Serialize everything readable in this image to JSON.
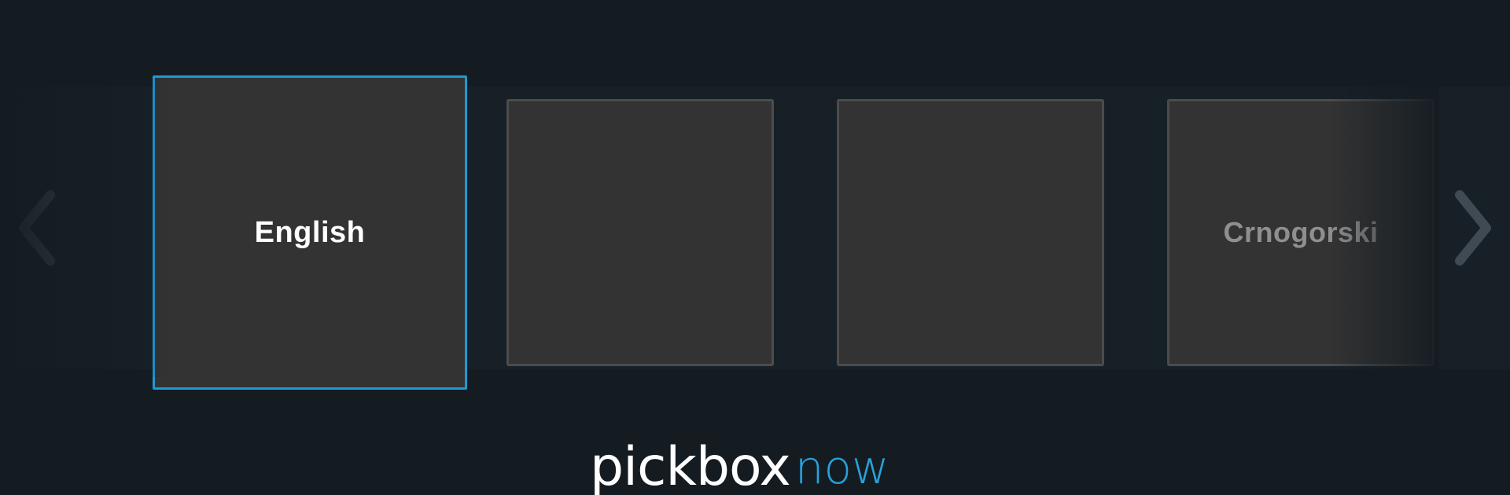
{
  "language_selector": {
    "tiles": [
      {
        "label": "English",
        "state": "selected"
      },
      {
        "label": "",
        "state": "unfocused"
      },
      {
        "label": "",
        "state": "unfocused"
      },
      {
        "label": "Crnogorski",
        "state": "unfocused"
      }
    ],
    "accent_color": "#1e9ad6",
    "tile_color": "#333333"
  },
  "navigation": {
    "prev_icon": "chevron-left-icon",
    "next_icon": "chevron-right-icon"
  },
  "logo": {
    "brand": "pickbox",
    "suffix": "now",
    "suffix_color": "#27a2dc"
  }
}
